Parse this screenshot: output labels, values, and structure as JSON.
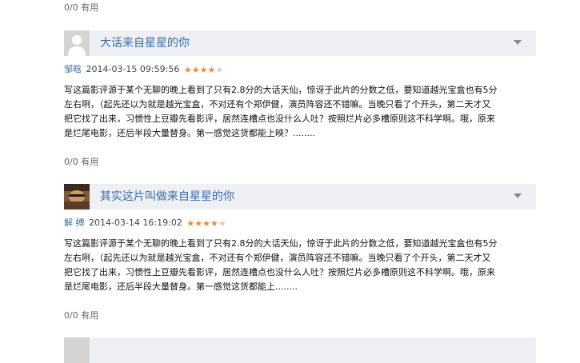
{
  "top_useful": "0/0 有用",
  "reviews": [
    {
      "title": "大话来自星星的你",
      "author": "邹晗",
      "date": "2014-03-15 09:59:56",
      "rating": 4,
      "max_rating": 5,
      "lines": [
        "写这篇影评源于某个无聊的晚上看到了只有2.8分的大话天仙，惊讶于此片的分数之低，要知道越光宝盒也有5分",
        "左右咧，（起先还以为就是越光宝盒，不对还有个郑伊健，演员阵容还不错嘛。当晚只看了个开头，第二天才又",
        "把它找了出来，习惯性上豆瓣先看影评，居然连槽点也没什么人吐？按照烂片必多槽原则这不科学啊。哦，原来",
        "是烂尾电影，还后半段大量替身。第一感觉这货都能上映？........"
      ],
      "useful": "0/0 有用",
      "avatar": "gray-placeholder"
    },
    {
      "title": "其实这片叫做来自星星的你",
      "author": "解 缚",
      "date": "2014-03-14 16:19:02",
      "rating": 4,
      "max_rating": 5,
      "lines": [
        "写这篇影评源于某个无聊的晚上看到了只有2.8分的大话天仙，惊讶于此片的分数之低，要知道越光宝盒也有5分",
        "左右咧，（起先还以为就是越光宝盒，不对还有个郑伊健，演员阵容还不错嘛。当晚只看了个开头，第二天才又",
        "把它找了出来，习惯性上豆瓣先看影评，居然连槽点也没什么人吐？按照烂片必多槽原则这不科学啊。哦，原来",
        "是烂尾电影，还后半段大量替身。第一感觉这货都能上........"
      ],
      "useful": "0/0 有用",
      "avatar": "photo-face"
    }
  ]
}
